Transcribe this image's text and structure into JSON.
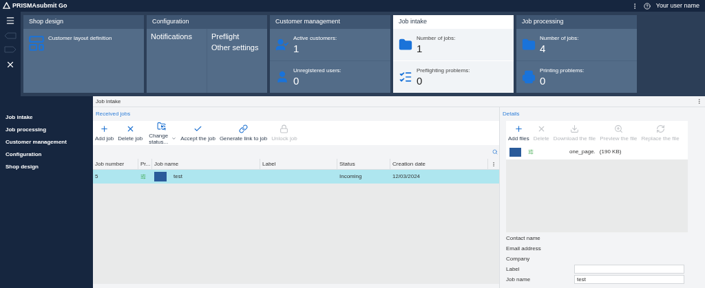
{
  "header": {
    "title": "PRISMAsubmit Go",
    "user_name": "Your user name"
  },
  "tiles": [
    {
      "title": "Shop design",
      "selected": false,
      "kind": "link",
      "items": [
        "Customer layout definition"
      ]
    },
    {
      "title": "Configuration",
      "selected": false,
      "kind": "columns",
      "columns": [
        [
          "Notifications"
        ],
        [
          "Preflight",
          "Other settings"
        ]
      ]
    },
    {
      "title": "Customer management",
      "selected": false,
      "kind": "stats",
      "stats": [
        {
          "label": "Active customers:",
          "value": "1"
        },
        {
          "label": "Unregistered users:",
          "value": "0"
        }
      ]
    },
    {
      "title": "Job intake",
      "selected": true,
      "kind": "stats",
      "stats": [
        {
          "label": "Number of jobs:",
          "value": "1"
        },
        {
          "label": "Preflighting problems:",
          "value": "0"
        }
      ]
    },
    {
      "title": "Job processing",
      "selected": false,
      "kind": "stats",
      "stats": [
        {
          "label": "Number of jobs:",
          "value": "4"
        },
        {
          "label": "Printing problems:",
          "value": "0"
        }
      ]
    }
  ],
  "nav": [
    "Job intake",
    "Job processing",
    "Customer management",
    "Configuration",
    "Shop design"
  ],
  "panel_title": "Job intake",
  "received_jobs": {
    "title": "Received jobs",
    "toolbar": [
      {
        "label": "Add job",
        "disabled": false
      },
      {
        "label": "Delete job",
        "disabled": false
      },
      {
        "label": "Change status...",
        "disabled": false,
        "dropdown": true
      },
      {
        "label": "Accept the job",
        "disabled": false
      },
      {
        "label": "Generate link to job",
        "disabled": false
      },
      {
        "label": "Unlock job",
        "disabled": true
      }
    ],
    "columns": [
      "Job number",
      "Pr...",
      "Job name",
      "Label",
      "Status",
      "Creation date"
    ],
    "rows": [
      {
        "job_number": "5",
        "job_name": "test",
        "status": "Incoming",
        "creation_date": "12/03/2024",
        "selected": true
      }
    ]
  },
  "details": {
    "title": "Details",
    "toolbar": [
      {
        "label": "Add files",
        "disabled": false
      },
      {
        "label": "Delete",
        "disabled": true
      },
      {
        "label": "Download the file",
        "disabled": true
      },
      {
        "label": "Preview the file",
        "disabled": true
      },
      {
        "label": "Replace the file",
        "disabled": true
      }
    ],
    "files": [
      {
        "name": "one_page.",
        "size": "(190 KB)"
      }
    ],
    "fields": [
      {
        "label": "Contact name",
        "kind": "text"
      },
      {
        "label": "Email address",
        "kind": "text"
      },
      {
        "label": "Company",
        "kind": "text"
      },
      {
        "label": "Label",
        "kind": "input"
      },
      {
        "label": "Job name",
        "kind": "input",
        "value": "test"
      }
    ]
  }
}
